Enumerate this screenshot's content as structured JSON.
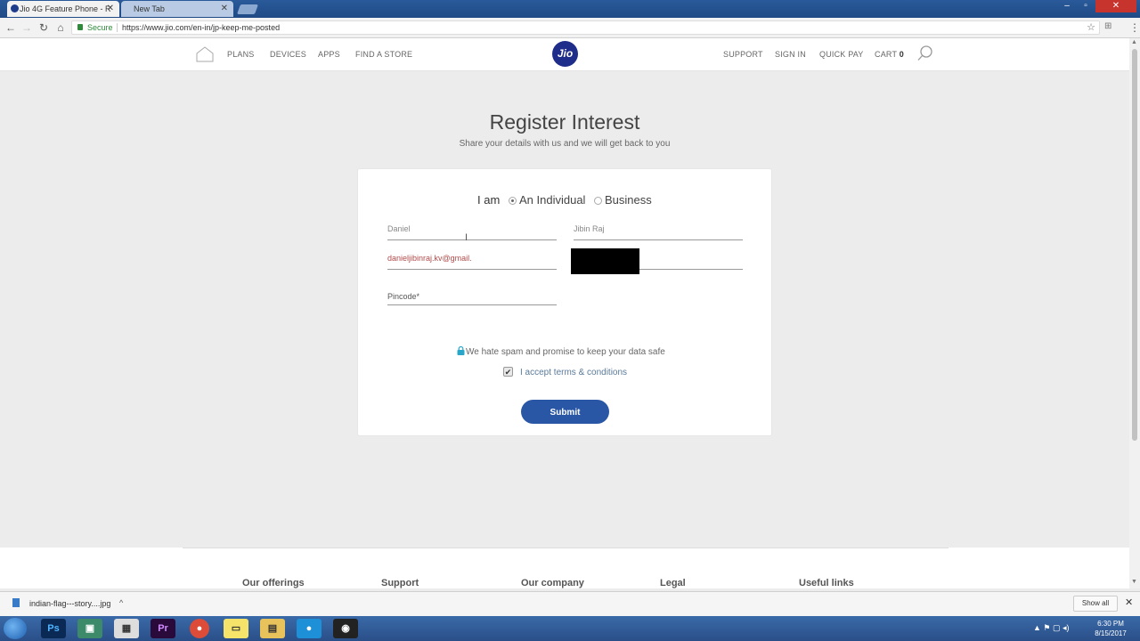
{
  "browser": {
    "tabs": [
      {
        "title": "Jio 4G Feature Phone - R"
      },
      {
        "title": "New Tab"
      }
    ],
    "secure_label": "Secure",
    "url": "https://www.jio.com/en-in/jp-keep-me-posted"
  },
  "site_nav": {
    "logo": "Jio",
    "left_links": [
      "PLANS",
      "DEVICES",
      "APPS",
      "FIND A STORE"
    ],
    "right_links": [
      "SUPPORT",
      "SIGN IN",
      "QUICK PAY"
    ],
    "cart_label": "CART",
    "cart_count": "0"
  },
  "page": {
    "title": "Register Interest",
    "subtitle": "Share your details with us and we will get back to you"
  },
  "form": {
    "iam_label": "I am",
    "radio_individual": "An Individual",
    "radio_business": "Business",
    "selected": "An Individual",
    "first_name": "Daniel",
    "last_name": "Jibin Raj",
    "email": "danieljibinraj.kv@gmail.",
    "pincode_placeholder": "Pincode*",
    "spam_note": "We hate spam and promise to keep your data safe",
    "terms_label": "I accept terms & conditions",
    "terms_checked": true,
    "submit_label": "Submit"
  },
  "footer": {
    "headings": [
      "Our offerings",
      "Support",
      "Our company",
      "Legal",
      "Useful links"
    ]
  },
  "download_shelf": {
    "file_name": "indian-flag---story....jpg",
    "show_all": "Show all"
  },
  "taskbar": {
    "time": "6:30 PM",
    "date": "8/15/2017"
  }
}
